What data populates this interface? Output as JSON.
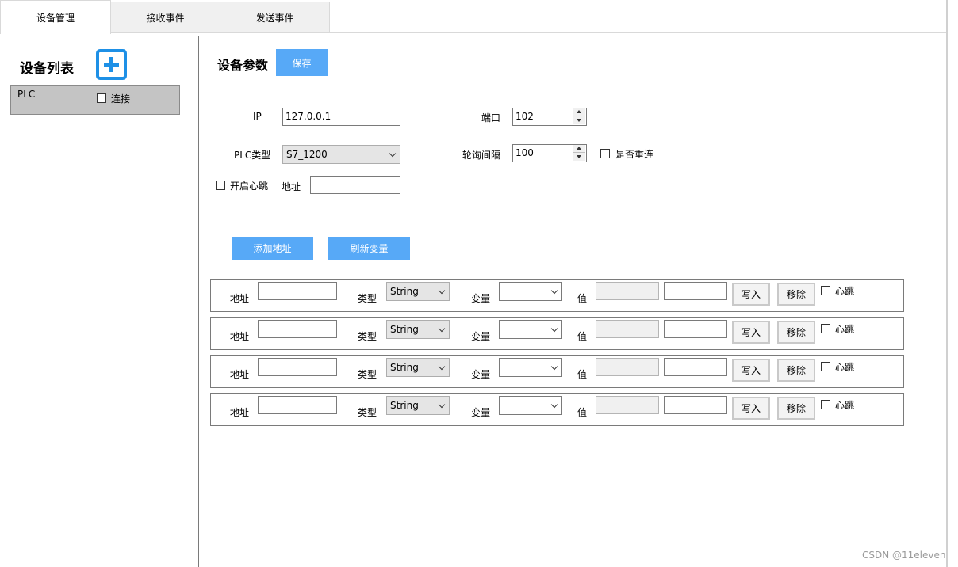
{
  "tabs": [
    {
      "label": "设备管理",
      "active": true
    },
    {
      "label": "接收事件",
      "active": false
    },
    {
      "label": "发送事件",
      "active": false
    }
  ],
  "device_list": {
    "title": "设备列表",
    "add_icon": "plus-icon",
    "items": [
      {
        "name": "PLC",
        "connect_label": "连接",
        "connected": false
      }
    ]
  },
  "params": {
    "title": "设备参数",
    "save_label": "保存",
    "ip_label": "IP",
    "ip_value": "127.0.0.1",
    "port_label": "端口",
    "port_value": "102",
    "plc_type_label": "PLC类型",
    "plc_type_value": "S7_1200",
    "poll_label": "轮询间隔",
    "poll_value": "100",
    "reconnect_label": "是否重连",
    "heartbeat_label": "开启心跳",
    "heartbeat_addr_label": "地址",
    "heartbeat_addr_value": "",
    "add_address_label": "添加地址",
    "refresh_label": "刷新变量"
  },
  "rows": [
    {
      "addr_label": "地址",
      "addr_value": "",
      "type_label": "类型",
      "type_value": "String",
      "var_label": "变量",
      "var_value": "",
      "value_label": "值",
      "value_read": "",
      "value_write": "",
      "write_label": "写入",
      "remove_label": "移除",
      "heartbeat_label": "心跳"
    },
    {
      "addr_label": "地址",
      "addr_value": "",
      "type_label": "类型",
      "type_value": "String",
      "var_label": "变量",
      "var_value": "",
      "value_label": "值",
      "value_read": "",
      "value_write": "",
      "write_label": "写入",
      "remove_label": "移除",
      "heartbeat_label": "心跳"
    },
    {
      "addr_label": "地址",
      "addr_value": "",
      "type_label": "类型",
      "type_value": "String",
      "var_label": "变量",
      "var_value": "",
      "value_label": "值",
      "value_read": "",
      "value_write": "",
      "write_label": "写入",
      "remove_label": "移除",
      "heartbeat_label": "心跳"
    },
    {
      "addr_label": "地址",
      "addr_value": "",
      "type_label": "类型",
      "type_value": "String",
      "var_label": "变量",
      "var_value": "",
      "value_label": "值",
      "value_read": "",
      "value_write": "",
      "write_label": "写入",
      "remove_label": "移除",
      "heartbeat_label": "心跳"
    }
  ],
  "watermark": "CSDN @11eleven",
  "colors": {
    "accent": "#57a9f7",
    "add_icon": "#1e90e6",
    "device_item_bg": "#c4c4c4"
  }
}
